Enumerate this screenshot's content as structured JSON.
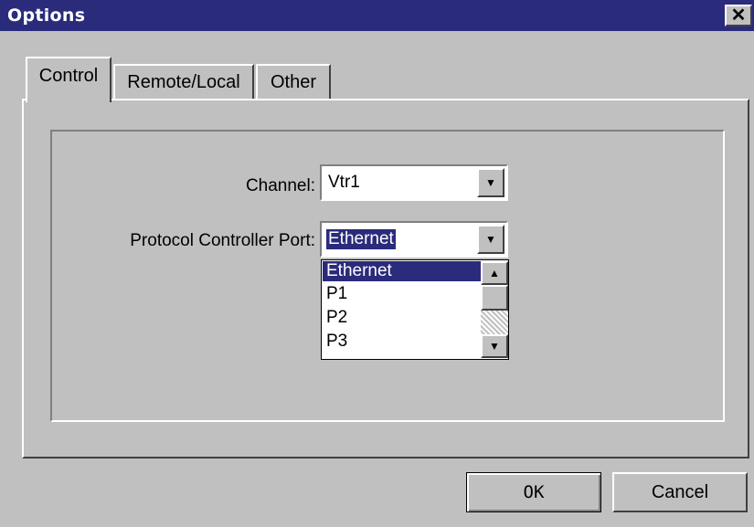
{
  "window": {
    "title": "Options",
    "close_glyph": "✕"
  },
  "tabs": [
    {
      "label": "Control",
      "active": true
    },
    {
      "label": "Remote/Local",
      "active": false
    },
    {
      "label": "Other",
      "active": false
    }
  ],
  "form": {
    "channel_label": "Channel:",
    "channel_value": "Vtr1",
    "port_label": "Protocol Controller Port:",
    "port_value": "Ethernet"
  },
  "port_dropdown": {
    "options": [
      "Ethernet",
      "P1",
      "P2",
      "P3"
    ],
    "highlighted": "Ethernet"
  },
  "icons": {
    "dropdown_arrow": "▼",
    "scroll_up": "▲",
    "scroll_down": "▼"
  },
  "buttons": {
    "ok_label": "OK",
    "cancel_label": "Cancel"
  },
  "colors": {
    "titlebar": "#2b2b7c",
    "selection": "#2b2b7c",
    "face": "#c0c0c0"
  }
}
